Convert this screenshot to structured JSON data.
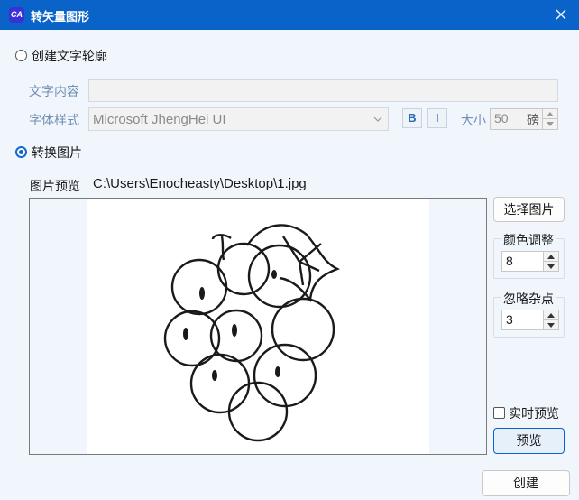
{
  "window": {
    "title": "转矢量图形",
    "app_icon_text": "CA"
  },
  "text_mode": {
    "radio_label": "创建文字轮廓",
    "content_label": "文字内容",
    "content_value": "",
    "font_label": "字体样式",
    "font_value": "Microsoft JhengHei UI",
    "bold_label": "B",
    "italic_label": "I",
    "size_label": "大小",
    "size_value": "50",
    "size_unit": "磅"
  },
  "image_mode": {
    "radio_label": "转换图片",
    "preview_label": "图片预览",
    "file_path": "C:\\Users\\Enocheasty\\Desktop\\1.jpg",
    "select_button": "选择图片",
    "color_group": "颜色调整",
    "color_value": "8",
    "noise_group": "忽略杂点",
    "noise_value": "3",
    "realtime_label": "实时预览",
    "preview_button": "预览"
  },
  "footer": {
    "create_button": "创建"
  },
  "colors": {
    "titlebar": "#0a63c9",
    "client_bg": "#f0f6fc",
    "accent": "#0a63c9"
  }
}
